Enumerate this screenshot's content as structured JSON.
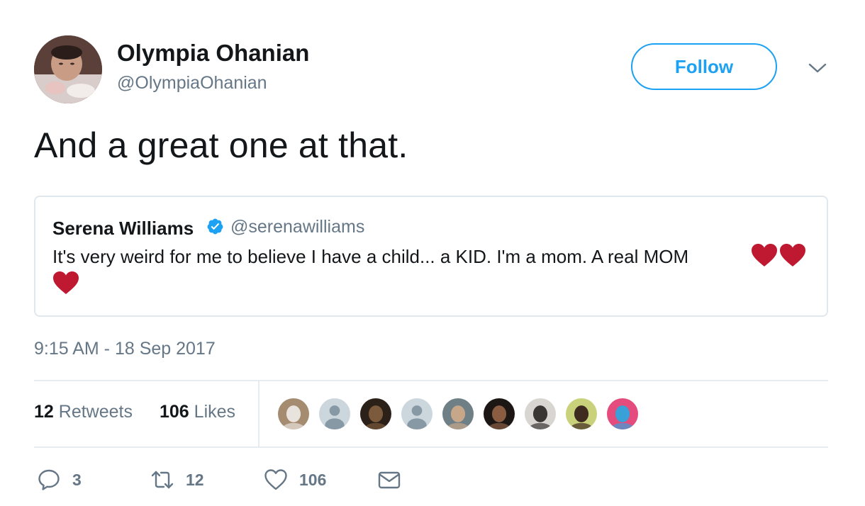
{
  "author": {
    "name": "Olympia Ohanian",
    "handle": "@OlympiaOhanian"
  },
  "follow_label": "Follow",
  "tweet_text": "And a great one at that.",
  "quoted_tweet": {
    "name": "Serena Williams",
    "handle": "@serenawilliams",
    "verified": true,
    "text": "It's very weird for me to believe I have a child... a KID. I'm a mom. A real MOM",
    "emoji": [
      "red-heart",
      "red-heart",
      "red-heart"
    ]
  },
  "timestamp": "9:15 AM - 18 Sep 2017",
  "stats": {
    "retweets_count": "12",
    "retweets_label": "Retweets",
    "likes_count": "106",
    "likes_label": "Likes"
  },
  "likers": [
    {
      "kind": "photo",
      "colors": [
        "#a58b70",
        "#e8e3dd"
      ]
    },
    {
      "kind": "default",
      "colors": [
        "#ccd6dd",
        "#8899a6"
      ]
    },
    {
      "kind": "photo",
      "colors": [
        "#2b2119",
        "#7c5a3c"
      ]
    },
    {
      "kind": "default",
      "colors": [
        "#ccd6dd",
        "#8899a6"
      ]
    },
    {
      "kind": "photo",
      "colors": [
        "#6f7f86",
        "#c7a78a"
      ]
    },
    {
      "kind": "photo",
      "colors": [
        "#1c1714",
        "#8a5d43"
      ]
    },
    {
      "kind": "photo",
      "colors": [
        "#d9d6d2",
        "#3a3633"
      ]
    },
    {
      "kind": "photo",
      "colors": [
        "#c9d27a",
        "#3f2a1f"
      ]
    },
    {
      "kind": "photo",
      "colors": [
        "#e34c7c",
        "#3aa0d8"
      ]
    }
  ],
  "actions": {
    "reply_count": "3",
    "retweet_count": "12",
    "like_count": "106"
  },
  "colors": {
    "brand_blue": "#1da1f2",
    "text_primary": "#14171a",
    "text_secondary": "#657786",
    "divider": "#e6ecf0",
    "heart_red": "#be1931"
  }
}
